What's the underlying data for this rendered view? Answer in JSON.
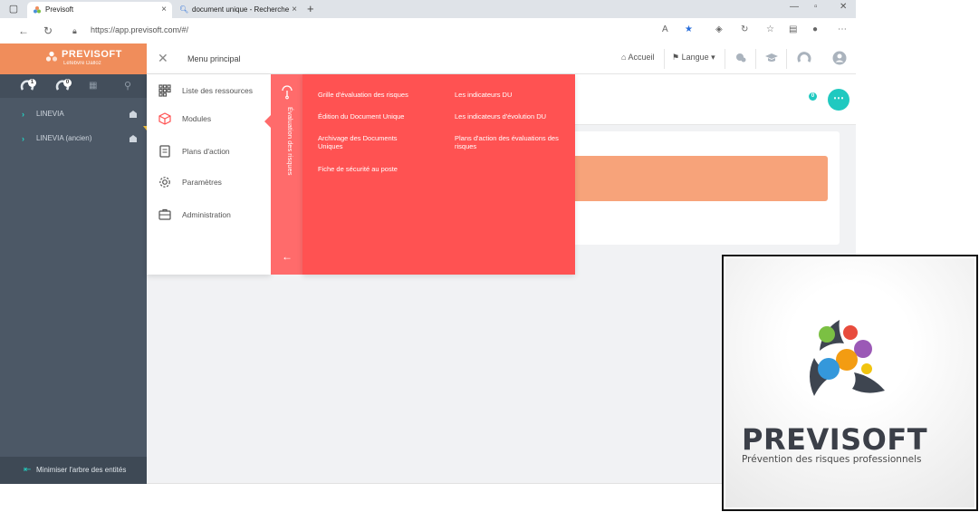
{
  "browser": {
    "tabs": [
      {
        "title": "Previsoft",
        "active": true
      },
      {
        "title": "document unique - Recherche",
        "active": false
      }
    ],
    "url": "https://app.previsoft.com/#/"
  },
  "header": {
    "brand": "PREVISOFT",
    "brand_sub": "Lefebvre Dalloz",
    "menu_title": "Menu principal",
    "home_label": "Accueil",
    "language_label": "Langue",
    "notification_count": "0"
  },
  "sidebar": {
    "badges": [
      "1",
      "0"
    ],
    "items": [
      {
        "label": "LINEVIA"
      },
      {
        "label": "LINEVIA (ancien)"
      }
    ],
    "minimize_label": "Minimiser l'arbre des entités"
  },
  "mega_menu": {
    "items": [
      {
        "label": "Liste des ressources",
        "icon": "grid-icon"
      },
      {
        "label": "Modules",
        "icon": "cube-icon"
      },
      {
        "label": "Plans d'action",
        "icon": "clipboard-icon"
      },
      {
        "label": "Paramètres",
        "icon": "gear-icon"
      },
      {
        "label": "Administration",
        "icon": "briefcase-icon"
      }
    ],
    "section_title": "Évaluation des risques",
    "links_col1": [
      "Grille d'évaluation des risques",
      "Édition du Document Unique",
      "Archivage des Documents Uniques",
      "Fiche de sécurité au poste"
    ],
    "links_col2": [
      "Les indicateurs DU",
      "Les indicateurs d'évolution DU",
      "Plans d'action des évaluations des risques"
    ]
  },
  "overlay_logo": {
    "brand": "PREVISOFT",
    "tagline": "Prévention des risques professionnels"
  },
  "colors": {
    "accent_orange": "#f08d5b",
    "menu_red": "#ff5252",
    "sidebar_dark": "#4c5866",
    "teal": "#20c9c0"
  }
}
